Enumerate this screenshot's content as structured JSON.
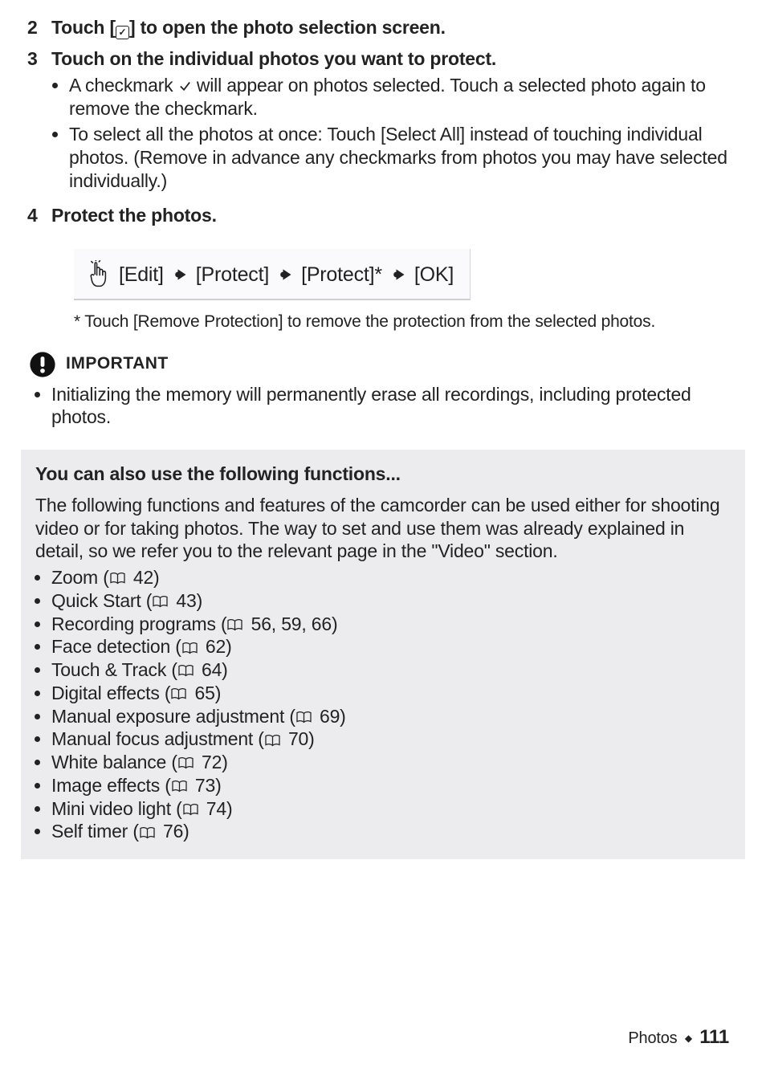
{
  "steps": {
    "s2": {
      "num": "2",
      "title_pre": "Touch [",
      "title_post": "] to open the photo selection screen."
    },
    "s3": {
      "num": "3",
      "title": "Touch on the individual photos you want to protect.",
      "b1_pre": "A checkmark ",
      "b1_post": " will appear on photos selected. Touch a selected photo again to remove the checkmark.",
      "b2": "To select all the photos at once: Touch [Select All] instead of touching individual photos. (Remove in advance any checkmarks from photos you may have selected individually.)"
    },
    "s4": {
      "num": "4",
      "title": "Protect the photos."
    }
  },
  "sequence": {
    "a": "[Edit]",
    "b": "[Protect]",
    "c": "[Protect]*",
    "d": "[OK]"
  },
  "footnote": "* Touch [Remove Protection] to remove the protection from the selected photos.",
  "important": {
    "label": "IMPORTANT",
    "b1": "Initializing the memory will permanently erase all recordings, including protected photos."
  },
  "box": {
    "heading": "You can also use the following functions...",
    "intro": "The following functions and features of the camcorder can be used either for shooting video or for taking photos. The way to set and use them was already explained in detail, so we refer you to the relevant page in the \"Video\" section.",
    "items": [
      {
        "label": "Zoom",
        "pages": "42"
      },
      {
        "label": "Quick Start",
        "pages": "43"
      },
      {
        "label": "Recording programs",
        "pages": "56, 59, 66"
      },
      {
        "label": "Face detection",
        "pages": "62"
      },
      {
        "label": "Touch & Track",
        "pages": "64"
      },
      {
        "label": "Digital effects",
        "pages": "65"
      },
      {
        "label": "Manual exposure adjustment",
        "pages": "69"
      },
      {
        "label": "Manual focus adjustment",
        "pages": "70"
      },
      {
        "label": "White balance",
        "pages": "72"
      },
      {
        "label": "Image effects",
        "pages": "73"
      },
      {
        "label": "Mini video light",
        "pages": "74"
      },
      {
        "label": "Self timer",
        "pages": "76"
      }
    ]
  },
  "footer": {
    "section": "Photos",
    "page": "111"
  }
}
